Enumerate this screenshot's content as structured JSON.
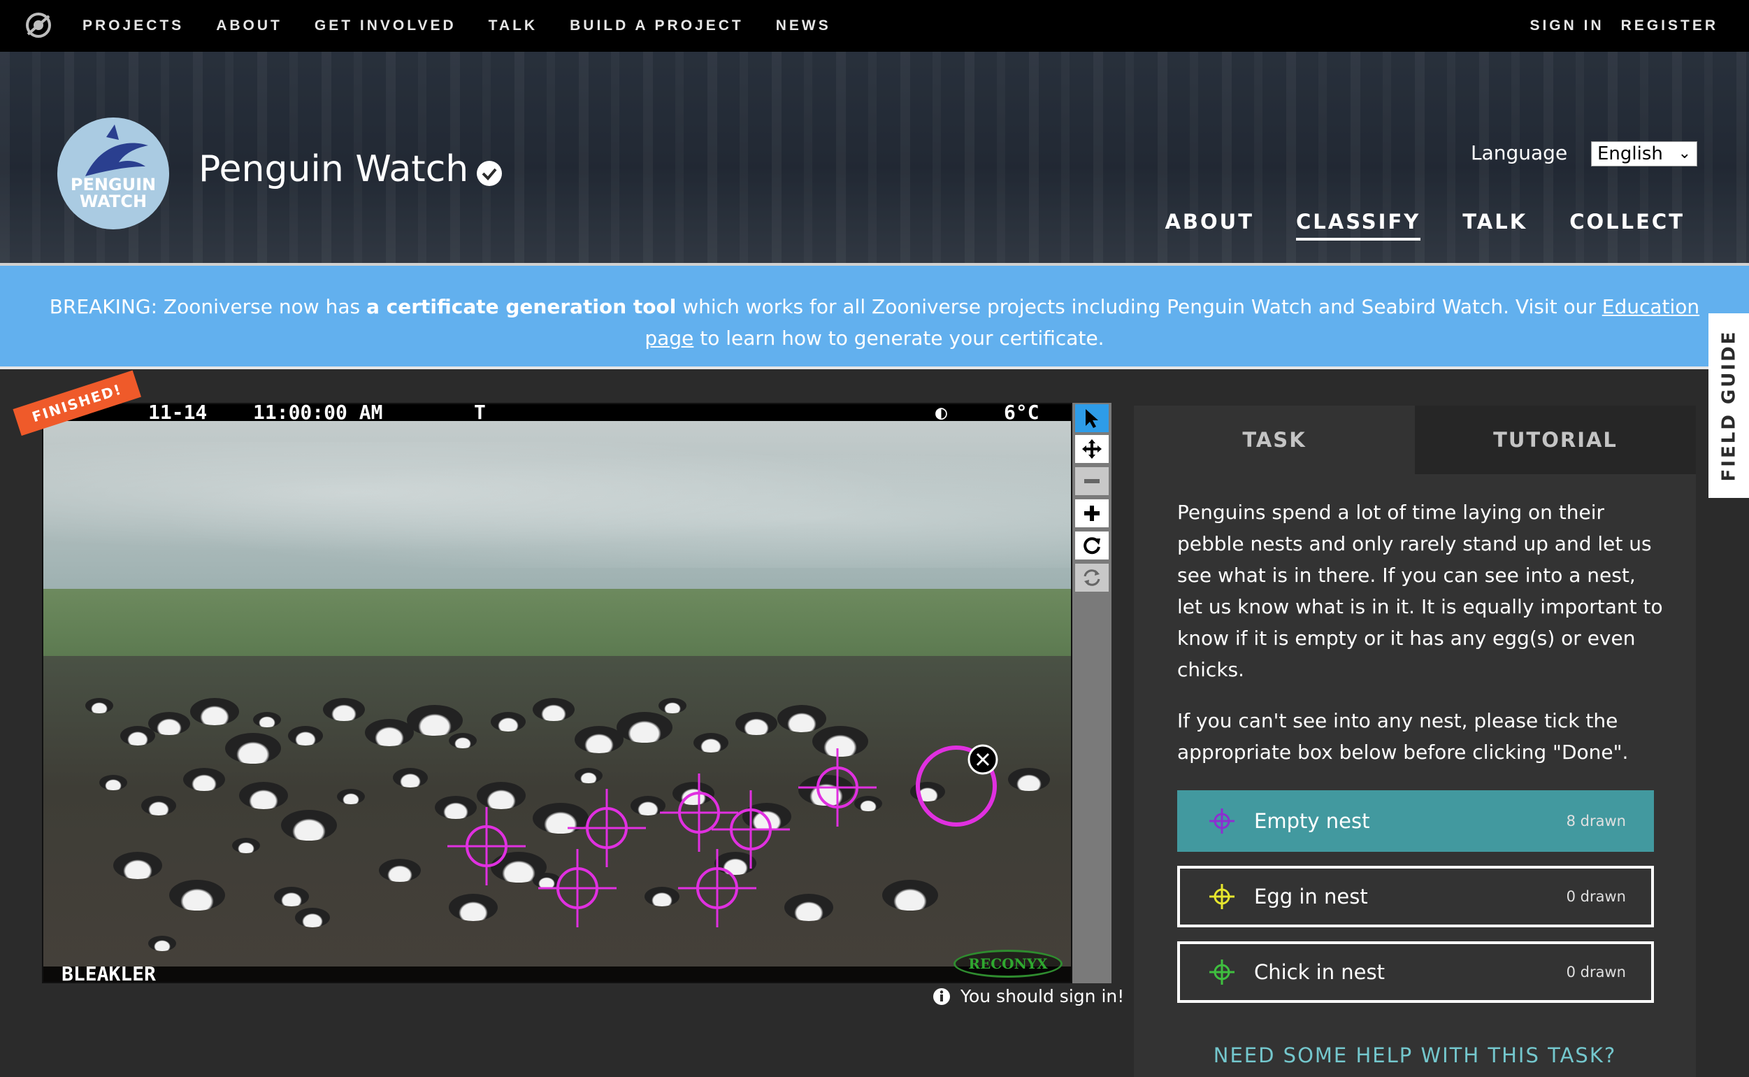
{
  "topnav": {
    "logo_icon": "zooniverse-logo-icon",
    "links": [
      "PROJECTS",
      "ABOUT",
      "GET INVOLVED",
      "TALK",
      "BUILD A PROJECT",
      "NEWS"
    ],
    "sign_in": "SIGN IN",
    "register": "REGISTER"
  },
  "project": {
    "avatar_text_line1": "PENGUIN",
    "avatar_text_line2": "WATCH",
    "title": "Penguin Watch",
    "verified_icon": "verified-check-icon",
    "language_label": "Language",
    "language_value": "English",
    "nav": [
      "ABOUT",
      "CLASSIFY",
      "TALK",
      "COLLECT"
    ],
    "active_nav": "CLASSIFY"
  },
  "banner": {
    "prefix": "BREAKING: Zooniverse now has ",
    "bold": "a certificate generation tool",
    "middle": " which works for all Zooniverse projects including Penguin Watch and Seabird Watch. Visit our ",
    "link": "Education page",
    "suffix": " to learn how to generate your certificate."
  },
  "field_guide": "FIELD GUIDE",
  "subject": {
    "finished_ribbon": "FINISHED!",
    "camera_stamp": {
      "datetime": "11-14",
      "time": "11:00:00 AM",
      "flag": "T",
      "temperature": "6°C"
    },
    "camera_name": "BLEAKLER",
    "camera_brand": "RECONYX",
    "mark_color": "#e030e0"
  },
  "toolbar": {
    "tools": [
      "pointer-icon",
      "move-icon",
      "zoom-out-icon",
      "zoom-in-icon",
      "rotate-icon",
      "reset-icon"
    ],
    "active_tool": "pointer-icon"
  },
  "signin_note": "You should sign in!",
  "panel": {
    "tabs": [
      "TASK",
      "TUTORIAL"
    ],
    "active_tab": "TASK",
    "description_1": "Penguins spend a lot of time laying on their pebble nests and only rarely stand up and let us see what is in there. If you can see into a nest, let us know what is in it. It is equally important to know if it is empty or it has any egg(s) or even chicks.",
    "description_2": "If you can't see into any nest, please tick the appropriate box below before clicking \"Done\".",
    "tools": [
      {
        "label": "Empty nest",
        "count": "8 drawn",
        "color": "#8c2fd0",
        "selected": true
      },
      {
        "label": "Egg in nest",
        "count": "0 drawn",
        "color": "#e6e62e",
        "selected": false
      },
      {
        "label": "Chick in nest",
        "count": "0 drawn",
        "color": "#3fbf3f",
        "selected": false
      }
    ],
    "help": "NEED SOME HELP WITH THIS TASK?"
  },
  "colors": {
    "banner": "#62b0ee",
    "selected_tool": "#42999f",
    "help_link": "#74c7cd",
    "finished": "#ef5a2a"
  }
}
